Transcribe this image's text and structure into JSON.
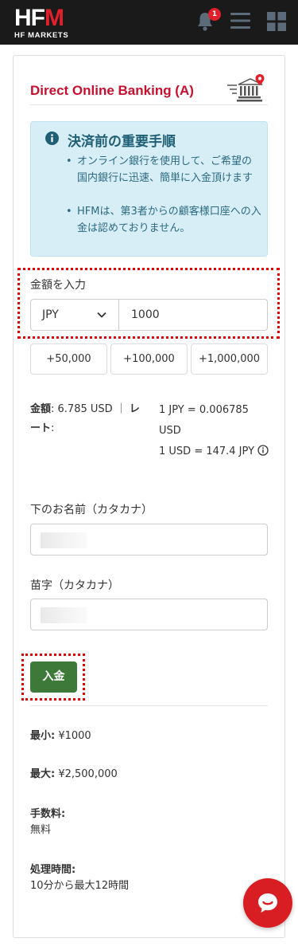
{
  "header": {
    "logo_main_a": "HF",
    "logo_main_b": "M",
    "logo_sub": "HF MARKETS",
    "notification_count": "1",
    "icons": [
      "bell-icon",
      "hamburger-menu-icon",
      "grid-icon"
    ]
  },
  "method": {
    "title": "Direct Online Banking (A)",
    "icon": "bank-location-icon"
  },
  "notice": {
    "title": "決済前の重要手順",
    "bullets": [
      "オンライン銀行を使用して、ご希望の国内銀行に迅速、簡単に入金頂けます",
      "HFMは、第3者からの顧客様口座への入金は認めておりません。"
    ]
  },
  "amount": {
    "label": "金額を入力",
    "currency": "JPY",
    "value": "1000",
    "quick": [
      "+50,000",
      "+100,000",
      "+1,000,000"
    ]
  },
  "rate": {
    "amount_label": "金額",
    "amount_value": ": 6.785 USD ｜ ",
    "rate_label": "レート",
    "rate_colon": ":",
    "line1": "1 JPY = 0.006785 USD",
    "line2": "1 USD = 147.4 JPY"
  },
  "form": {
    "first_name_label": "下のお名前（カタカナ）",
    "last_name_label": "苗字（カタカナ）",
    "deposit_button": "入金"
  },
  "limits": {
    "min_label": "最小:",
    "min_value": " ¥1000",
    "max_label": "最大:",
    "max_value": " ¥2,500,000",
    "fee_label": "手数料:",
    "fee_value": "無料",
    "time_label": "処理時間:",
    "time_value": "10分から最大12時間"
  },
  "colors": {
    "brand_red": "#e1202b",
    "title_red": "#c8102e",
    "deposit_green": "#3d7a3a",
    "info_bg": "#d8eef6",
    "highlight": "#e10000"
  }
}
